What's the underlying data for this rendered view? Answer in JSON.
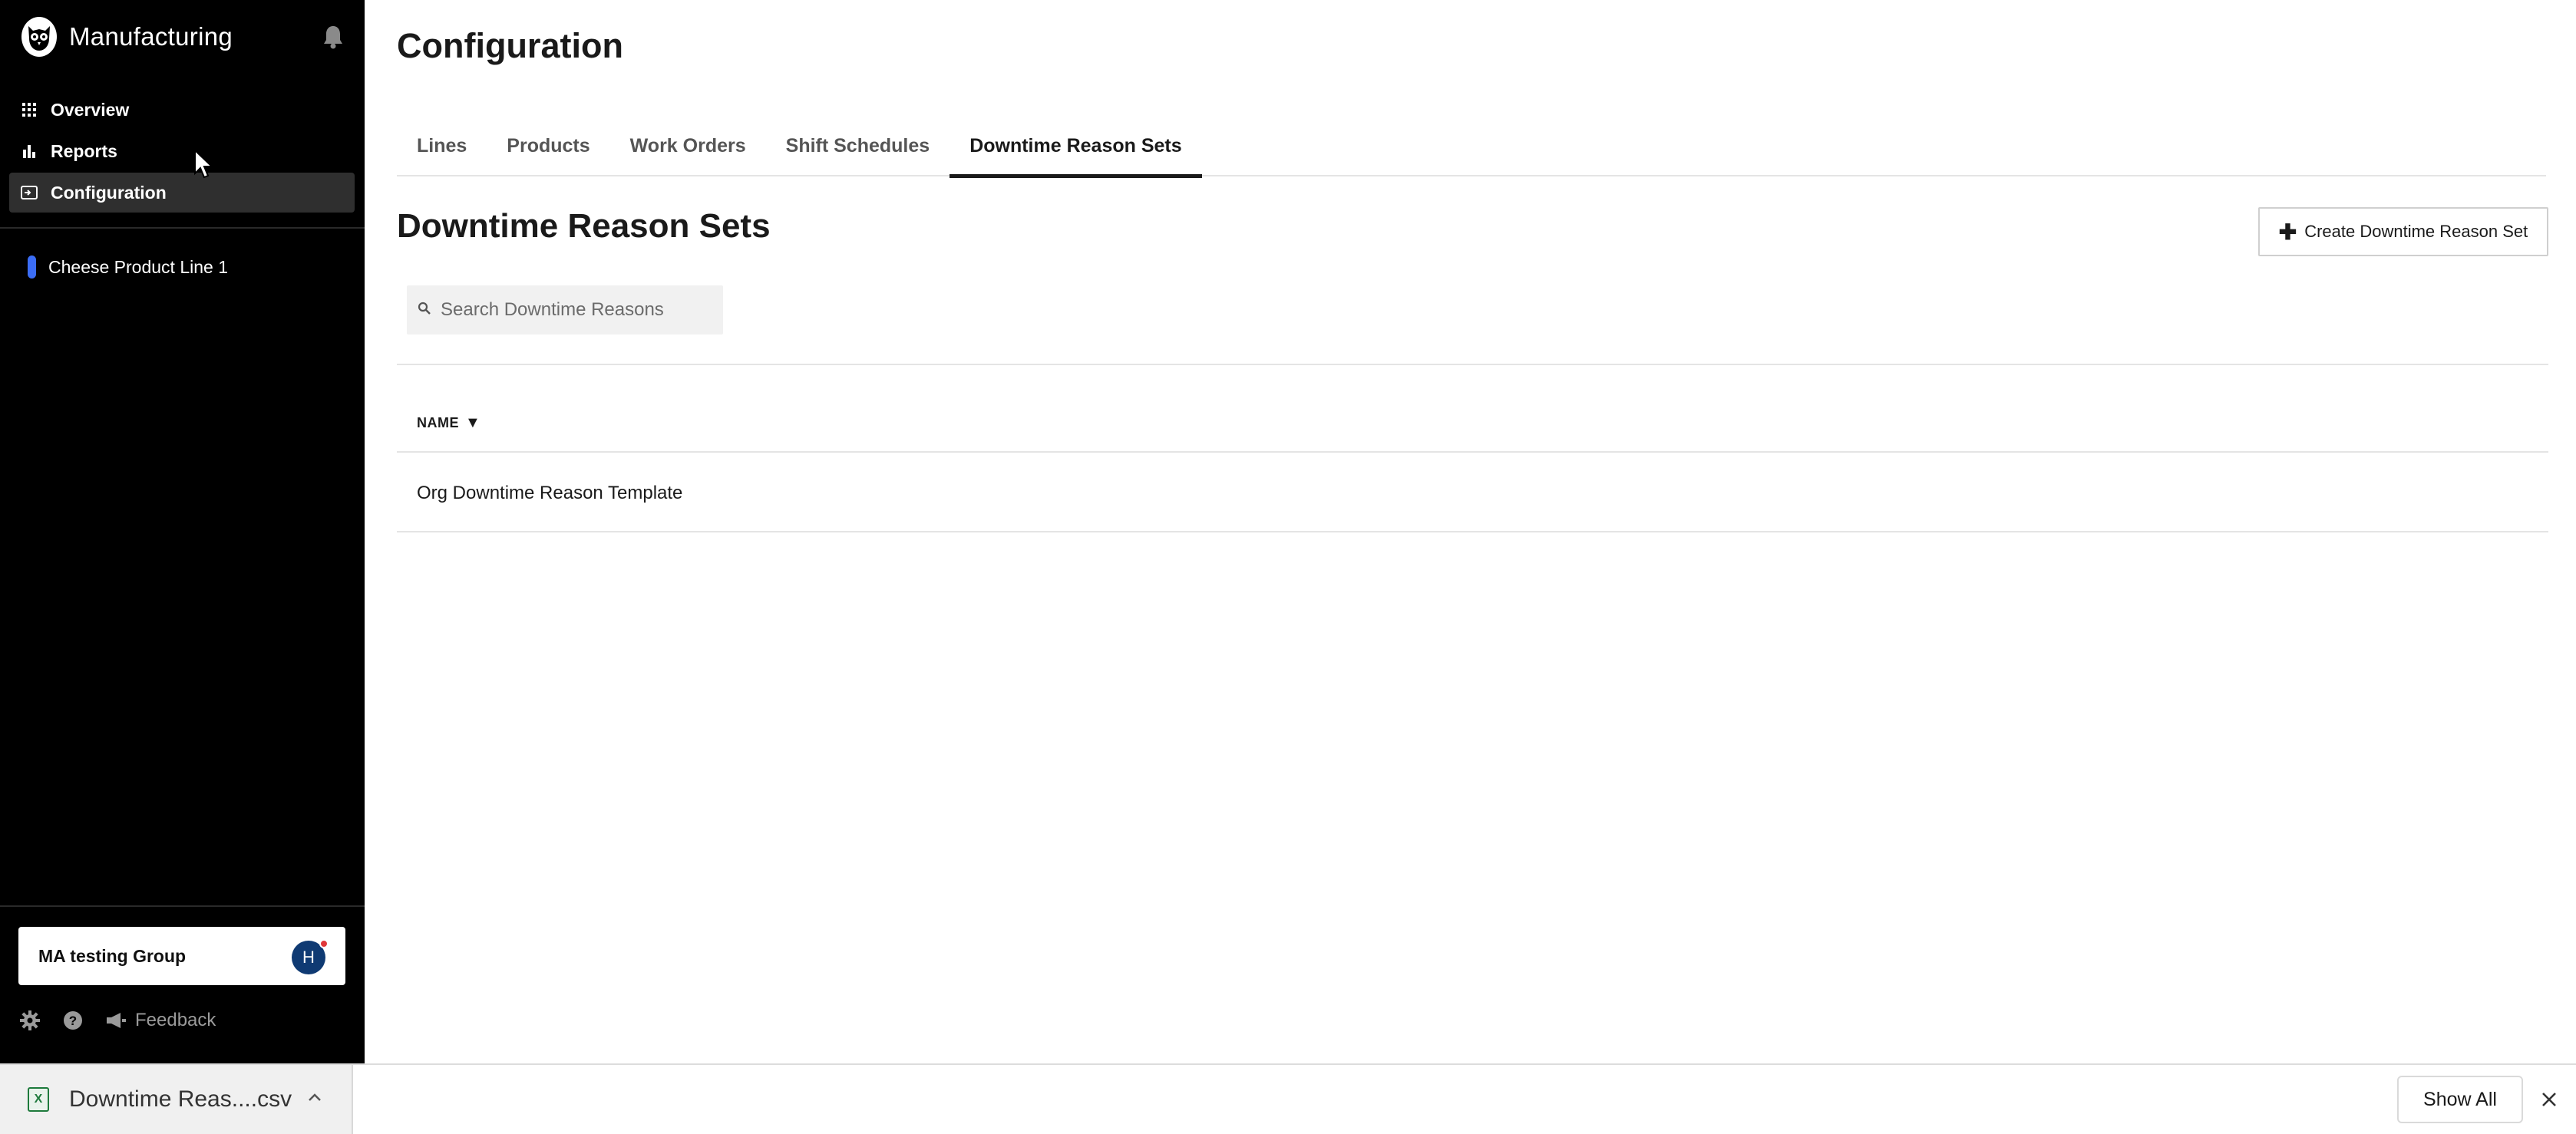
{
  "sidebar": {
    "app_title": "Manufacturing",
    "nav": [
      {
        "label": "Overview",
        "icon": "grid-icon"
      },
      {
        "label": "Reports",
        "icon": "bar-chart-icon"
      },
      {
        "label": "Configuration",
        "icon": "config-icon",
        "active": true
      }
    ],
    "line_name": "Cheese Product Line 1",
    "line_color": "#3b6df5",
    "group": {
      "name": "MA testing Group",
      "avatar_initial": "H"
    },
    "footer": {
      "feedback_label": "Feedback"
    }
  },
  "main": {
    "page_title": "Configuration",
    "tabs": [
      {
        "label": "Lines"
      },
      {
        "label": "Products"
      },
      {
        "label": "Work Orders"
      },
      {
        "label": "Shift Schedules"
      },
      {
        "label": "Downtime Reason Sets",
        "active": true
      }
    ],
    "section_title": "Downtime Reason Sets",
    "create_button_label": "Create Downtime Reason Set",
    "search_placeholder": "Search Downtime Reasons",
    "table": {
      "column_name": "NAME",
      "sort_indicator": "▼",
      "rows": [
        "Org Downtime Reason Template"
      ]
    }
  },
  "download_bar": {
    "file_name": "Downtime Reas....csv",
    "show_all_label": "Show All"
  }
}
